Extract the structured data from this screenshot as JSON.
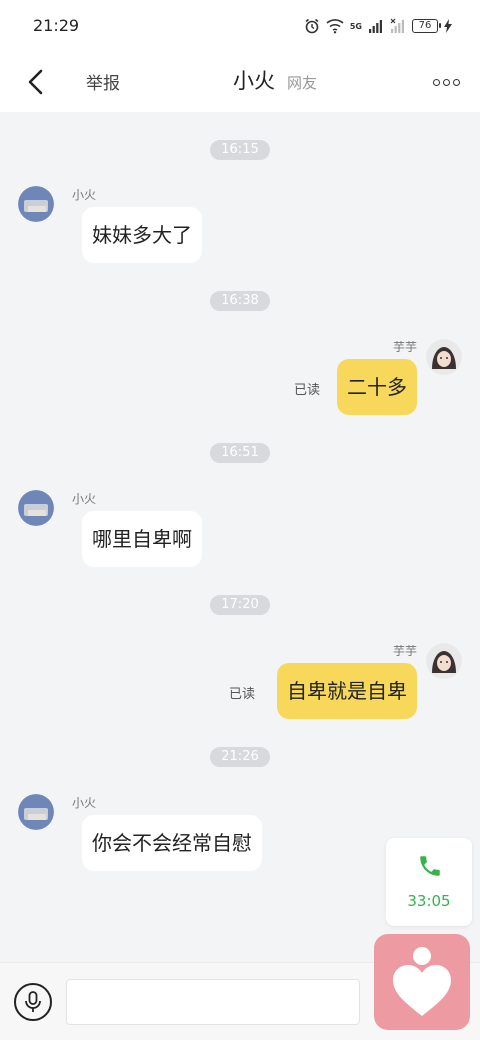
{
  "status_bar": {
    "time": "21:29",
    "battery": "76"
  },
  "header": {
    "report_label": "举报",
    "title": "小火",
    "subtitle": "网友"
  },
  "timestamps": [
    "16:15",
    "16:38",
    "16:51",
    "17:20",
    "21:26"
  ],
  "messages": [
    {
      "side": "left",
      "sender": "小火",
      "text": "妹妹多大了"
    },
    {
      "side": "right",
      "sender": "芋芋",
      "text": "二十多",
      "status": "已读"
    },
    {
      "side": "left",
      "sender": "小火",
      "text": "哪里自卑啊"
    },
    {
      "side": "right",
      "sender": "芋芋",
      "text": "自卑就是自卑",
      "status": "已读"
    },
    {
      "side": "left",
      "sender": "小火",
      "text": "你会不会经常自慰"
    }
  ],
  "call_widget": {
    "duration": "33:05",
    "color": "#37b24d"
  },
  "input": {
    "placeholder": ""
  },
  "colors": {
    "accent_bubble": "#f7d85b",
    "heart_button": "#ee9aa2",
    "background": "#f3f4f6"
  }
}
